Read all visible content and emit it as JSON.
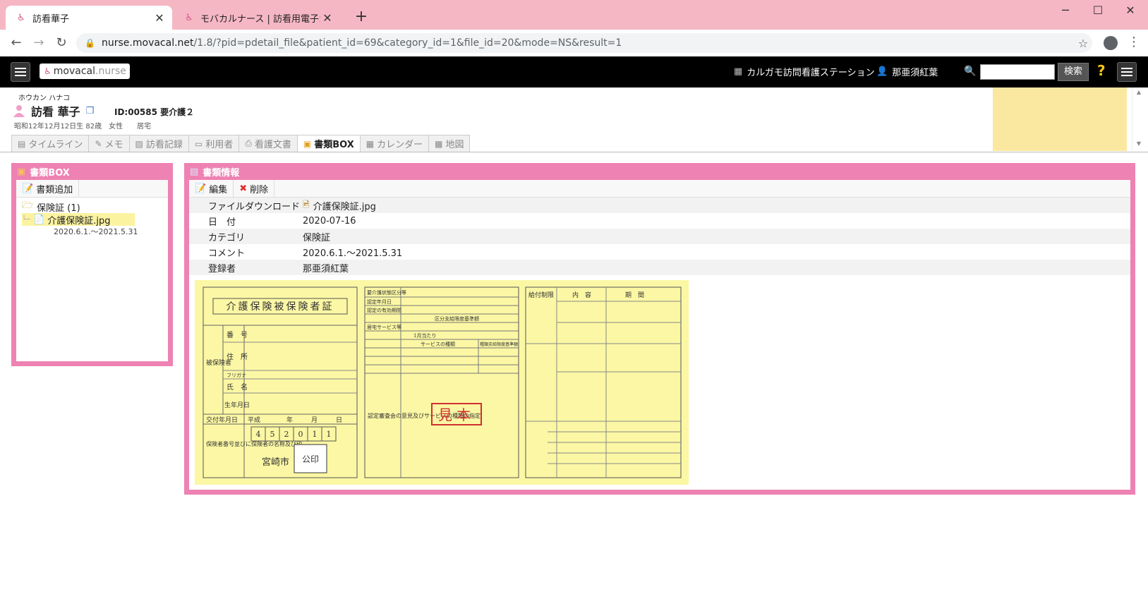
{
  "browser": {
    "tabs": [
      {
        "title": "訪看華子"
      },
      {
        "title": "モバカルナース | 訪看用電子カルテ"
      }
    ],
    "url_host": "nurse.movacal.net",
    "url_path": "/1.8/?pid=pdetail_file&patient_id=69&category_id=1&file_id=20&mode=NS&result=1"
  },
  "header": {
    "logo_main": "movacal",
    "logo_sub": ".nurse",
    "station": "カルガモ訪問看護ステーション",
    "user": "那亜須紅葉",
    "search_label": "検索",
    "search_value": "",
    "help": "?"
  },
  "patient": {
    "kana": "ホウカン ハナコ",
    "name": "訪看 華子",
    "id_care": "ID:00585 要介護２",
    "meta": "昭和12年12月12日生 82歳　女性　　居宅"
  },
  "tabs": [
    {
      "label": "タイムライン"
    },
    {
      "label": "メモ"
    },
    {
      "label": "訪看記録"
    },
    {
      "label": "利用者"
    },
    {
      "label": "看護文書"
    },
    {
      "label": "書類BOX"
    },
    {
      "label": "カレンダー"
    },
    {
      "label": "地図"
    }
  ],
  "box": {
    "title": "書類BOX",
    "add_label": "書類追加",
    "folder": "保険証 (1)",
    "file": "介護保険証.jpg",
    "file_date": "2020.6.1.～2021.5.31"
  },
  "info": {
    "title": "書類情報",
    "edit_label": "編集",
    "delete_label": "削除",
    "rows": [
      {
        "k": "ファイルダウンロード",
        "v": "介護保険証.jpg"
      },
      {
        "k": "日　付",
        "v": "2020-07-16"
      },
      {
        "k": "カテゴリ",
        "v": "保険証"
      },
      {
        "k": "コメント",
        "v": "2020.6.1.～2021.5.31"
      },
      {
        "k": "登録者",
        "v": "那亜須紅葉"
      }
    ]
  },
  "insurance_card": {
    "title": "介護保険被保険者証",
    "labels": [
      "番　号",
      "住　所",
      "フリガナ",
      "氏　名",
      "生年月日",
      "交付年月日"
    ],
    "side_label": "被保険者",
    "insurer_label": "保険者番号並びに保険者の名称及び印",
    "insurer_no": [
      "4",
      "5",
      "2",
      "0",
      "1",
      "1"
    ],
    "insurer_name": "宮崎市",
    "seal": "公印",
    "era": "平成",
    "year_month_day": [
      "年",
      "月",
      "日"
    ],
    "mid_labels": [
      "要介護状態区分等",
      "認定年月日",
      "認定の有効期間",
      "区分支給限度基準額",
      "居宅サービス等",
      "1月当たり",
      "サービスの種類",
      "種類支給限度基準額"
    ],
    "opinion_label": "認定審査会の意見及びサービスの種類の指定",
    "sample": "見本",
    "right_headers": [
      "給付制限",
      "内　容",
      "期　間"
    ]
  }
}
